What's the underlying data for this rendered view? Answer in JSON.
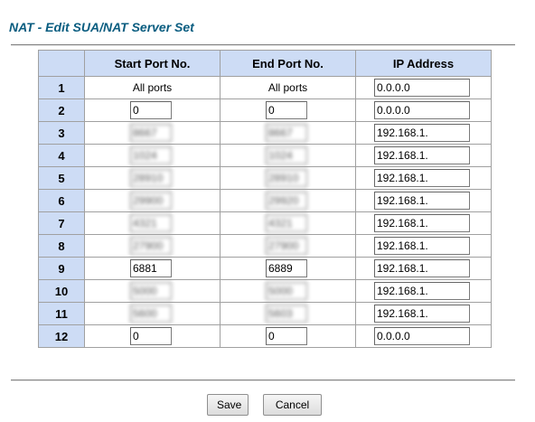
{
  "title": "NAT - Edit SUA/NAT Server Set",
  "table": {
    "headers": [
      "",
      "Start Port No.",
      "End Port No.",
      "IP Address"
    ],
    "rows": [
      {
        "num": "1",
        "start": "All ports",
        "end": "All ports",
        "ip": "0.0.0.0",
        "editable_ports": false,
        "obscured": false
      },
      {
        "num": "2",
        "start": "0",
        "end": "0",
        "ip": "0.0.0.0",
        "editable_ports": true,
        "obscured": false
      },
      {
        "num": "3",
        "start": "8667",
        "end": "8667",
        "ip": "192.168.1.",
        "editable_ports": true,
        "obscured": true
      },
      {
        "num": "4",
        "start": "1024",
        "end": "1024",
        "ip": "192.168.1.",
        "editable_ports": true,
        "obscured": true
      },
      {
        "num": "5",
        "start": "28910",
        "end": "28910",
        "ip": "192.168.1.",
        "editable_ports": true,
        "obscured": true
      },
      {
        "num": "6",
        "start": "29900",
        "end": "29920",
        "ip": "192.168.1.",
        "editable_ports": true,
        "obscured": true
      },
      {
        "num": "7",
        "start": "4321",
        "end": "4321",
        "ip": "192.168.1.",
        "editable_ports": true,
        "obscured": true
      },
      {
        "num": "8",
        "start": "27900",
        "end": "27900",
        "ip": "192.168.1.",
        "editable_ports": true,
        "obscured": true
      },
      {
        "num": "9",
        "start": "6881",
        "end": "6889",
        "ip": "192.168.1.",
        "editable_ports": true,
        "obscured": false
      },
      {
        "num": "10",
        "start": "5000",
        "end": "5000",
        "ip": "192.168.1.",
        "editable_ports": true,
        "obscured": true
      },
      {
        "num": "11",
        "start": "5600",
        "end": "5603",
        "ip": "192.168.1.",
        "editable_ports": true,
        "obscured": true
      },
      {
        "num": "12",
        "start": "0",
        "end": "0",
        "ip": "0.0.0.0",
        "editable_ports": true,
        "obscured": false
      }
    ]
  },
  "buttons": {
    "save": "Save",
    "cancel": "Cancel"
  },
  "colors": {
    "title": "#0a5d80",
    "header_bg": "#cddcf5",
    "border": "#a0a0a0"
  }
}
